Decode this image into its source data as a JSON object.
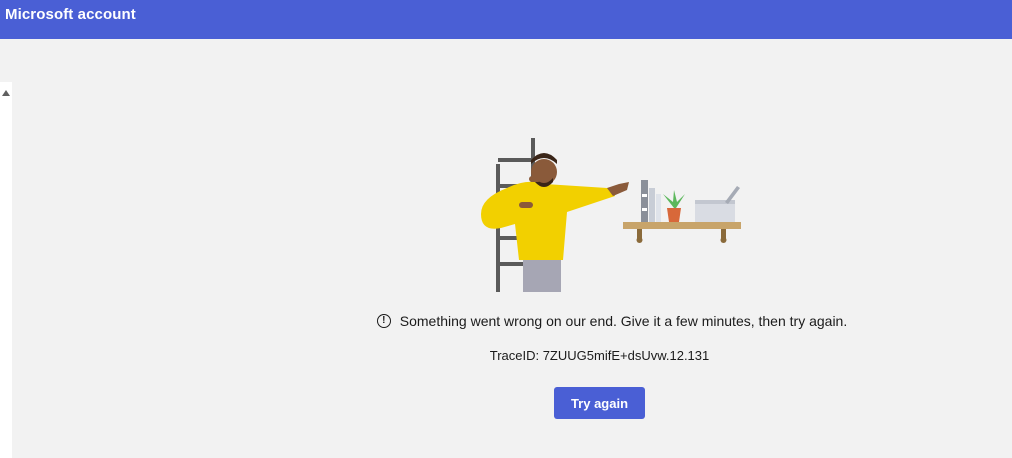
{
  "window": {
    "title": "Microsoft account"
  },
  "error": {
    "message": "Something went wrong on our end. Give it a few minutes, then try again.",
    "icon": "info-circle-icon",
    "trace_id": "TraceID: 7ZUUG5mifE+dsUvw.12.131"
  },
  "actions": {
    "retry_label": "Try again"
  },
  "colors": {
    "accent": "#4a5fd5",
    "background": "#f2f2f2",
    "text": "#1b1b1b"
  }
}
